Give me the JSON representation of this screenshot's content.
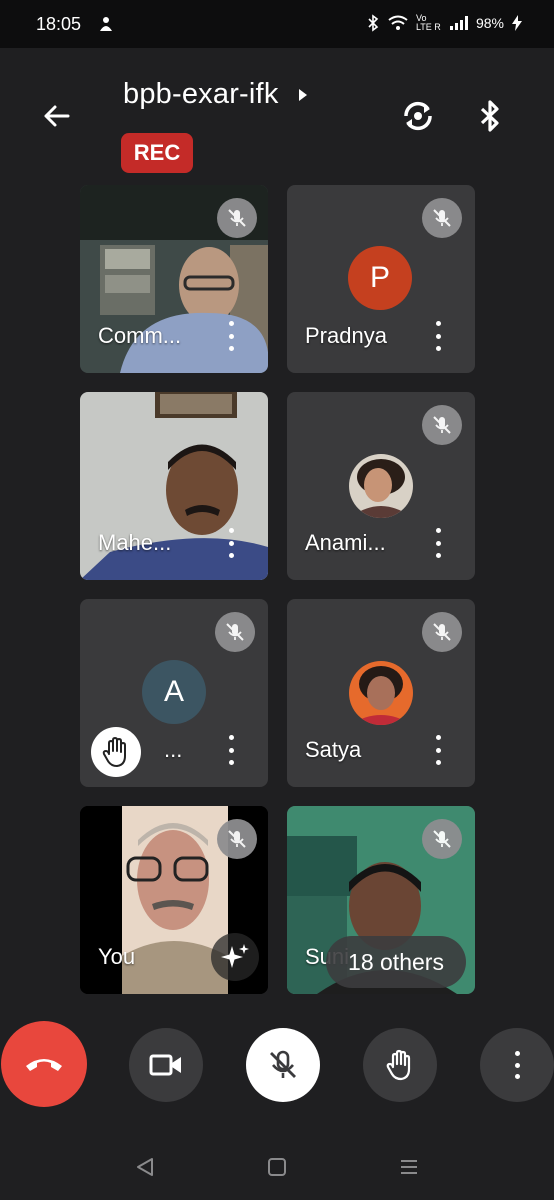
{
  "status_bar": {
    "time": "18:05",
    "battery": "98%",
    "net_label": "Vo LTE R"
  },
  "meeting": {
    "code": "bpb-exar-ifk",
    "rec_label": "REC"
  },
  "colors": {
    "end_call": "#e8473d",
    "rec": "#c42b28",
    "avatar_p": "#c5401f",
    "avatar_a": "#3c5562"
  },
  "tiles": [
    {
      "name": "Comm...",
      "muted": true,
      "type": "video"
    },
    {
      "name": "Pradnya",
      "muted": true,
      "type": "avatar",
      "initial": "P"
    },
    {
      "name": "Mahe...",
      "muted": false,
      "type": "video"
    },
    {
      "name": "Anami...",
      "muted": true,
      "type": "photo"
    },
    {
      "name": "...",
      "muted": true,
      "type": "avatar",
      "initial": "A",
      "hand_raised": true
    },
    {
      "name": "Satya",
      "muted": true,
      "type": "photo"
    },
    {
      "name": "You",
      "muted": true,
      "type": "video"
    },
    {
      "name": "Suni",
      "muted": true,
      "type": "video"
    }
  ],
  "others_label": "18 others",
  "controls": [
    "end-call",
    "camera",
    "microphone",
    "raise-hand",
    "more"
  ]
}
